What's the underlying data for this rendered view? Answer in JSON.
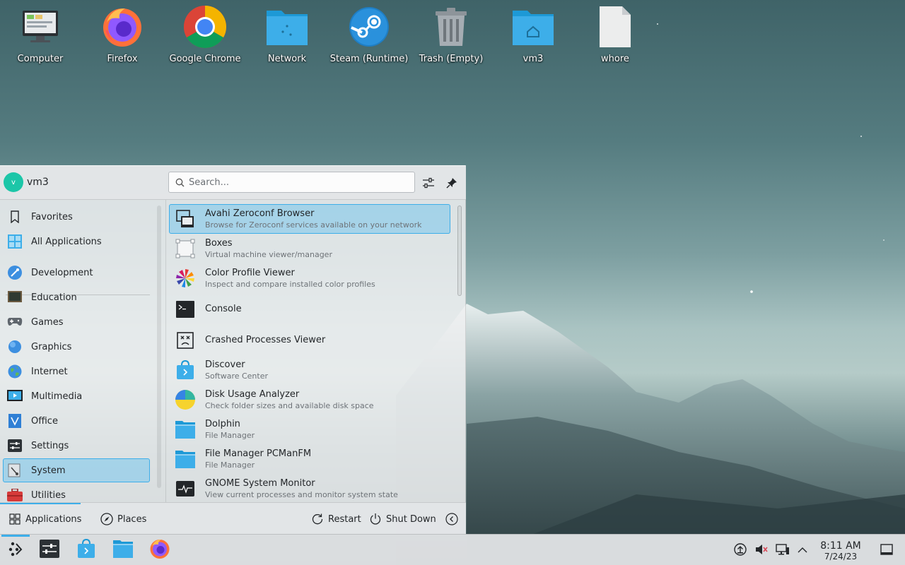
{
  "desktop": {
    "icons": [
      {
        "label": "Computer",
        "icon": "computer-icon"
      },
      {
        "label": "Firefox",
        "icon": "firefox-icon"
      },
      {
        "label": "Google Chrome",
        "icon": "chrome-icon"
      },
      {
        "label": "Network",
        "icon": "network-folder-icon"
      },
      {
        "label": "Steam (Runtime)",
        "icon": "steam-icon"
      },
      {
        "label": "Trash (Empty)",
        "icon": "trash-icon"
      },
      {
        "label": "vm3",
        "icon": "home-folder-icon"
      },
      {
        "label": "whore",
        "icon": "file-icon"
      }
    ]
  },
  "launcher": {
    "user": {
      "name": "vm3",
      "avatar_letter": "v"
    },
    "search": {
      "placeholder": "Search..."
    },
    "categories": [
      {
        "label": "Favorites",
        "icon": "bookmark-icon"
      },
      {
        "label": "All Applications",
        "icon": "grid-icon"
      },
      {
        "label": "Development",
        "icon": "development-icon"
      },
      {
        "label": "Education",
        "icon": "education-icon"
      },
      {
        "label": "Games",
        "icon": "gamepad-icon"
      },
      {
        "label": "Graphics",
        "icon": "graphics-icon"
      },
      {
        "label": "Internet",
        "icon": "globe-icon"
      },
      {
        "label": "Multimedia",
        "icon": "multimedia-icon"
      },
      {
        "label": "Office",
        "icon": "office-icon"
      },
      {
        "label": "Settings",
        "icon": "settings-icon"
      },
      {
        "label": "System",
        "icon": "system-icon",
        "selected": true
      },
      {
        "label": "Utilities",
        "icon": "toolbox-icon"
      }
    ],
    "apps": [
      {
        "name": "Avahi Zeroconf Browser",
        "description": "Browse for Zeroconf services available on your network",
        "icon": "avahi-icon",
        "selected": true
      },
      {
        "name": "Boxes",
        "description": "Virtual machine viewer/manager",
        "icon": "boxes-icon"
      },
      {
        "name": "Color Profile Viewer",
        "description": "Inspect and compare installed color profiles",
        "icon": "color-profile-icon"
      },
      {
        "name": "Console",
        "description": "",
        "icon": "console-icon"
      },
      {
        "name": "Crashed Processes Viewer",
        "description": "",
        "icon": "crash-viewer-icon"
      },
      {
        "name": "Discover",
        "description": "Software Center",
        "icon": "discover-icon"
      },
      {
        "name": "Disk Usage Analyzer",
        "description": "Check folder sizes and available disk space",
        "icon": "disk-usage-icon"
      },
      {
        "name": "Dolphin",
        "description": "File Manager",
        "icon": "dolphin-icon"
      },
      {
        "name": "File Manager PCManFM",
        "description": "File Manager",
        "icon": "pcmanfm-icon"
      },
      {
        "name": "GNOME System Monitor",
        "description": "View current processes and monitor system state",
        "icon": "system-monitor-icon"
      }
    ],
    "footer": {
      "applications_label": "Applications",
      "places_label": "Places",
      "restart_label": "Restart",
      "shutdown_label": "Shut Down"
    }
  },
  "taskbar": {
    "items": [
      "app-launcher-icon",
      "system-settings-icon",
      "discover-icon",
      "dolphin-icon",
      "firefox-icon"
    ],
    "tray": [
      "updates-icon",
      "volume-muted-icon",
      "network-wired-icon",
      "chevron-up-icon"
    ],
    "clock": {
      "time": "8:11 AM",
      "date": "7/24/23"
    }
  },
  "colors": {
    "accent": "#3daee9",
    "selection": "#93cee9",
    "text": "#232629"
  }
}
